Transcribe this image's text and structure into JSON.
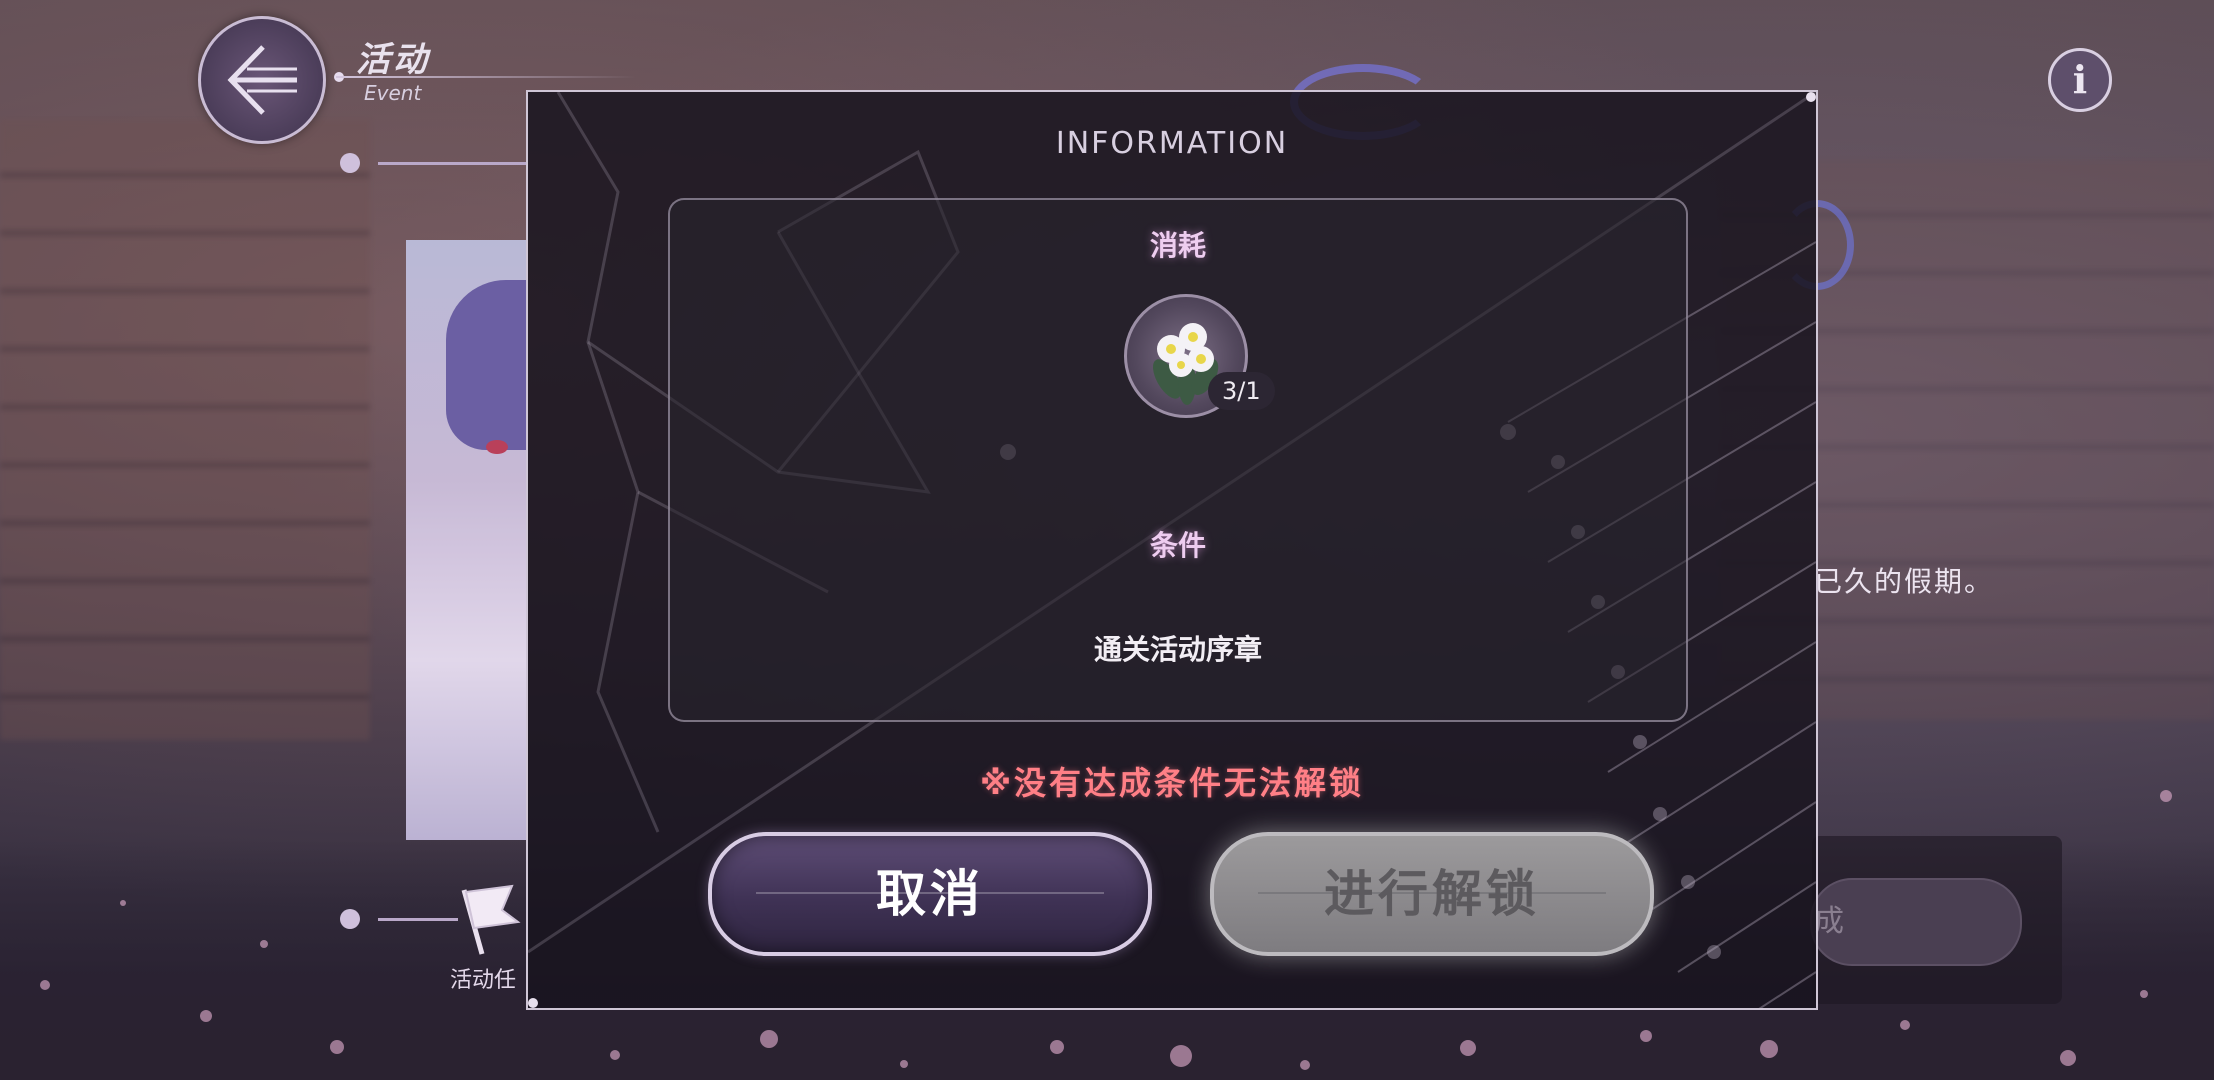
{
  "header": {
    "title_cn": "活动",
    "title_en": "Event"
  },
  "background": {
    "description_fragment": "已久的假期。",
    "task_label_fragment": "活动任",
    "right_button_fragment": "成"
  },
  "modal": {
    "title": "INFORMATION",
    "cost_label": "消耗",
    "item": {
      "icon": "edelweiss-flower-icon",
      "count": "3/1"
    },
    "condition_label": "条件",
    "condition_text": "通关活动序章",
    "warning": "※没有达成条件无法解锁",
    "cancel_label": "取消",
    "unlock_label": "进行解锁"
  },
  "colors": {
    "warning": "#ff7f86",
    "section_label": "#eecdf0",
    "cancel_bg": "#3f3255",
    "unlock_bg_disabled": "#8a888c"
  }
}
